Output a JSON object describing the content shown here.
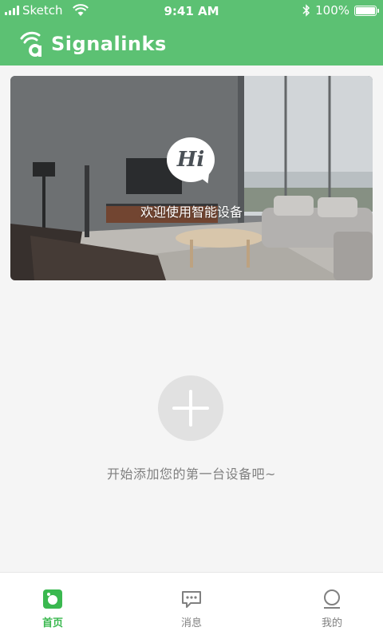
{
  "status_bar": {
    "carrier": "Sketch",
    "time": "9:41 AM",
    "battery": "100%"
  },
  "header": {
    "app_title": "Signalinks",
    "logo_icon": "signal-a-logo-icon"
  },
  "hero": {
    "greeting": "Hi",
    "caption": "欢迎使用智能设备"
  },
  "empty_state": {
    "text": "开始添加您的第一台设备吧~",
    "add_icon": "plus-icon"
  },
  "tab_bar": {
    "tabs": [
      {
        "label": "首页",
        "icon": "home-icon",
        "active": true
      },
      {
        "label": "消息",
        "icon": "message-icon",
        "active": false
      },
      {
        "label": "我的",
        "icon": "profile-icon",
        "active": false
      }
    ]
  },
  "colors": {
    "brand": "#5cc173",
    "active_tab": "#3ab84f",
    "muted_text": "#808080"
  }
}
